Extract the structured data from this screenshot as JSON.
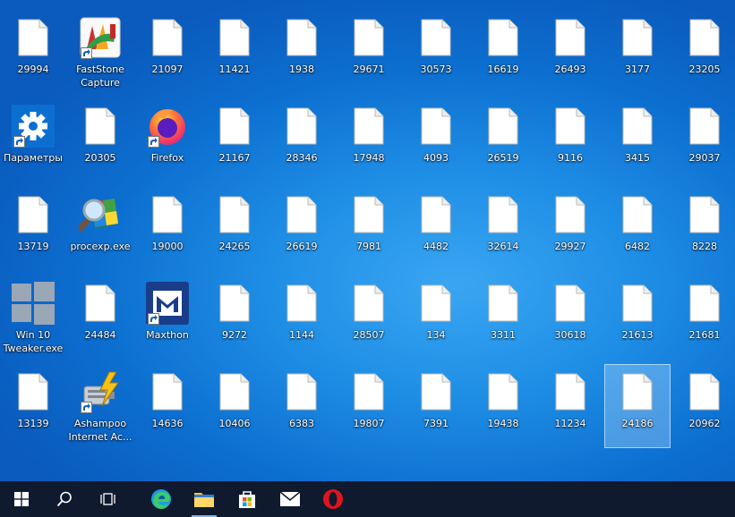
{
  "desktop": {
    "icons": [
      {
        "label": "29994",
        "type": "file"
      },
      {
        "label": "FastStone Capture",
        "type": "faststone"
      },
      {
        "label": "21097",
        "type": "file"
      },
      {
        "label": "11421",
        "type": "file"
      },
      {
        "label": "1938",
        "type": "file"
      },
      {
        "label": "29671",
        "type": "file"
      },
      {
        "label": "30573",
        "type": "file"
      },
      {
        "label": "16619",
        "type": "file"
      },
      {
        "label": "26493",
        "type": "file"
      },
      {
        "label": "3177",
        "type": "file"
      },
      {
        "label": "23205",
        "type": "file"
      },
      {
        "label": "Параметры",
        "type": "settings"
      },
      {
        "label": "20305",
        "type": "file"
      },
      {
        "label": "Firefox",
        "type": "firefox"
      },
      {
        "label": "21167",
        "type": "file"
      },
      {
        "label": "28346",
        "type": "file"
      },
      {
        "label": "17948",
        "type": "file"
      },
      {
        "label": "4093",
        "type": "file"
      },
      {
        "label": "26519",
        "type": "file"
      },
      {
        "label": "9116",
        "type": "file"
      },
      {
        "label": "3415",
        "type": "file"
      },
      {
        "label": "29037",
        "type": "file"
      },
      {
        "label": "13719",
        "type": "file"
      },
      {
        "label": "procexp.exe",
        "type": "procexp"
      },
      {
        "label": "19000",
        "type": "file"
      },
      {
        "label": "24265",
        "type": "file"
      },
      {
        "label": "26619",
        "type": "file"
      },
      {
        "label": "7981",
        "type": "file"
      },
      {
        "label": "4482",
        "type": "file"
      },
      {
        "label": "32614",
        "type": "file"
      },
      {
        "label": "29927",
        "type": "file"
      },
      {
        "label": "6482",
        "type": "file"
      },
      {
        "label": "8228",
        "type": "file"
      },
      {
        "label": "Win 10 Tweaker.exe",
        "type": "win10"
      },
      {
        "label": "24484",
        "type": "file"
      },
      {
        "label": "Maxthon",
        "type": "maxthon"
      },
      {
        "label": "9272",
        "type": "file"
      },
      {
        "label": "1144",
        "type": "file"
      },
      {
        "label": "28507",
        "type": "file"
      },
      {
        "label": "134",
        "type": "file"
      },
      {
        "label": "3311",
        "type": "file"
      },
      {
        "label": "30618",
        "type": "file"
      },
      {
        "label": "21613",
        "type": "file"
      },
      {
        "label": "21681",
        "type": "file"
      },
      {
        "label": "13139",
        "type": "file"
      },
      {
        "label": "Ashampoo Internet Ac...",
        "type": "ashampoo"
      },
      {
        "label": "14636",
        "type": "file"
      },
      {
        "label": "10406",
        "type": "file"
      },
      {
        "label": "6383",
        "type": "file"
      },
      {
        "label": "19807",
        "type": "file"
      },
      {
        "label": "7391",
        "type": "file"
      },
      {
        "label": "19438",
        "type": "file"
      },
      {
        "label": "11234",
        "type": "file"
      },
      {
        "label": "24186",
        "type": "file",
        "selected": true
      },
      {
        "label": "20962",
        "type": "file"
      }
    ]
  },
  "taskbar": {
    "buttons": [
      {
        "name": "start-button",
        "icon": "windows-logo-icon"
      },
      {
        "name": "search-button",
        "icon": "search-icon"
      },
      {
        "name": "task-view-button",
        "icon": "task-view-icon"
      },
      {
        "name": "edge-button",
        "icon": "edge-icon"
      },
      {
        "name": "file-explorer-button",
        "icon": "folder-icon",
        "active": true
      },
      {
        "name": "store-button",
        "icon": "store-icon"
      },
      {
        "name": "mail-button",
        "icon": "mail-icon"
      },
      {
        "name": "opera-button",
        "icon": "opera-icon"
      }
    ]
  }
}
